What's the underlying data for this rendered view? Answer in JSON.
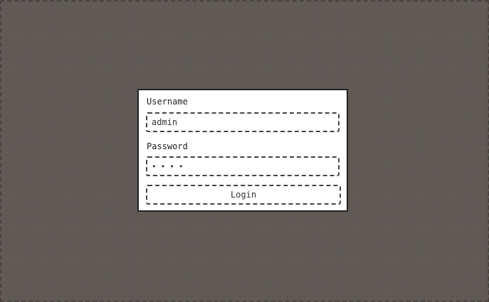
{
  "login": {
    "username_label": "Username",
    "username_value": "admin",
    "password_label": "Password",
    "password_value": "****",
    "login_button_label": "Login"
  },
  "colors": {
    "background": "#5f5955",
    "panel": "#ffffff",
    "border": "#222222"
  }
}
